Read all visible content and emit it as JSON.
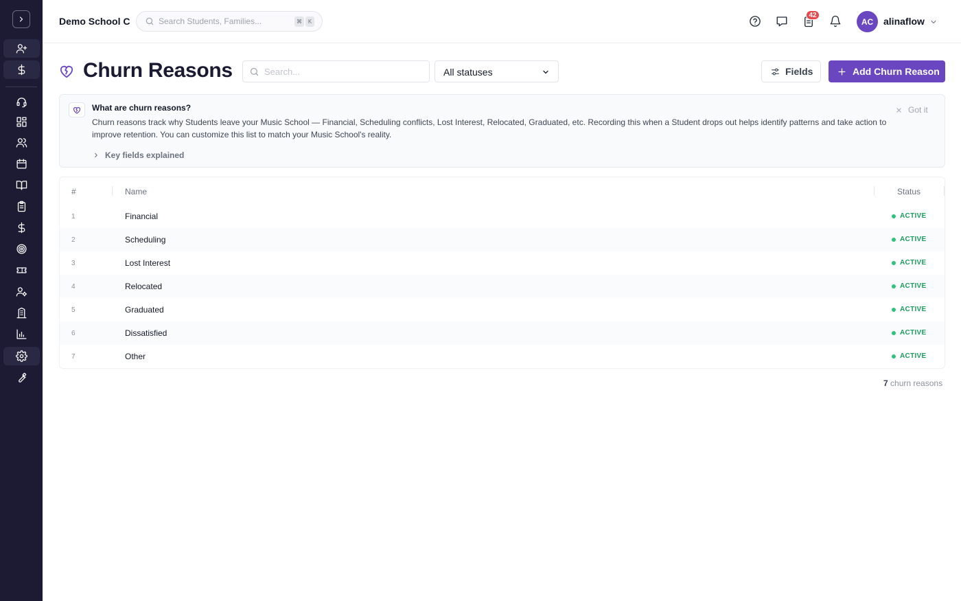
{
  "topbar": {
    "school_name": "Demo School C",
    "search_placeholder": "Search Students, Families...",
    "kbd_mod": "⌘",
    "kbd_key": "K",
    "tasks_badge": "42",
    "avatar_initials": "AC",
    "username": "alinaflow"
  },
  "header": {
    "title": "Churn Reasons",
    "search_placeholder": "Search...",
    "status_filter": "All statuses",
    "fields_label": "Fields",
    "add_label": "Add Churn Reason"
  },
  "callout": {
    "title": "What are churn reasons?",
    "text": "Churn reasons track why Students leave your Music School — Financial, Scheduling conflicts, Lost Interest, Relocated, Graduated, etc. Recording this when a Student drops out helps identify patterns and take action to improve retention. You can customize this list to match your Music School's reality.",
    "dismiss_label": "Got it",
    "key_fields_label": "Key fields explained"
  },
  "table": {
    "columns": {
      "num": "#",
      "name": "Name",
      "status": "Status"
    },
    "rows": [
      {
        "num": "1",
        "name": "Financial",
        "status": "ACTIVE"
      },
      {
        "num": "2",
        "name": "Scheduling",
        "status": "ACTIVE"
      },
      {
        "num": "3",
        "name": "Lost Interest",
        "status": "ACTIVE"
      },
      {
        "num": "4",
        "name": "Relocated",
        "status": "ACTIVE"
      },
      {
        "num": "5",
        "name": "Graduated",
        "status": "ACTIVE"
      },
      {
        "num": "6",
        "name": "Dissatisfied",
        "status": "ACTIVE"
      },
      {
        "num": "7",
        "name": "Other",
        "status": "ACTIVE"
      }
    ]
  },
  "footer": {
    "count": "7",
    "count_label": "churn reasons"
  },
  "colors": {
    "accent": "#6b46c1",
    "sidebar": "#1c1b33",
    "active_status": "#1a9d5e",
    "badge": "#e5484d"
  },
  "icons": [
    "chevron-right-icon",
    "user-plus-icon",
    "dollar-icon",
    "headset-icon",
    "dashboard-icon",
    "users-icon",
    "calendar-icon",
    "book-icon",
    "clipboard-icon",
    "target-icon",
    "ticket-icon",
    "user-gear-icon",
    "building-icon",
    "bar-chart-icon",
    "gear-icon",
    "wrench-icon",
    "help-icon",
    "message-icon",
    "tasks-icon",
    "bell-icon",
    "heart-broken-icon",
    "sliders-icon",
    "plus-icon",
    "close-icon"
  ]
}
